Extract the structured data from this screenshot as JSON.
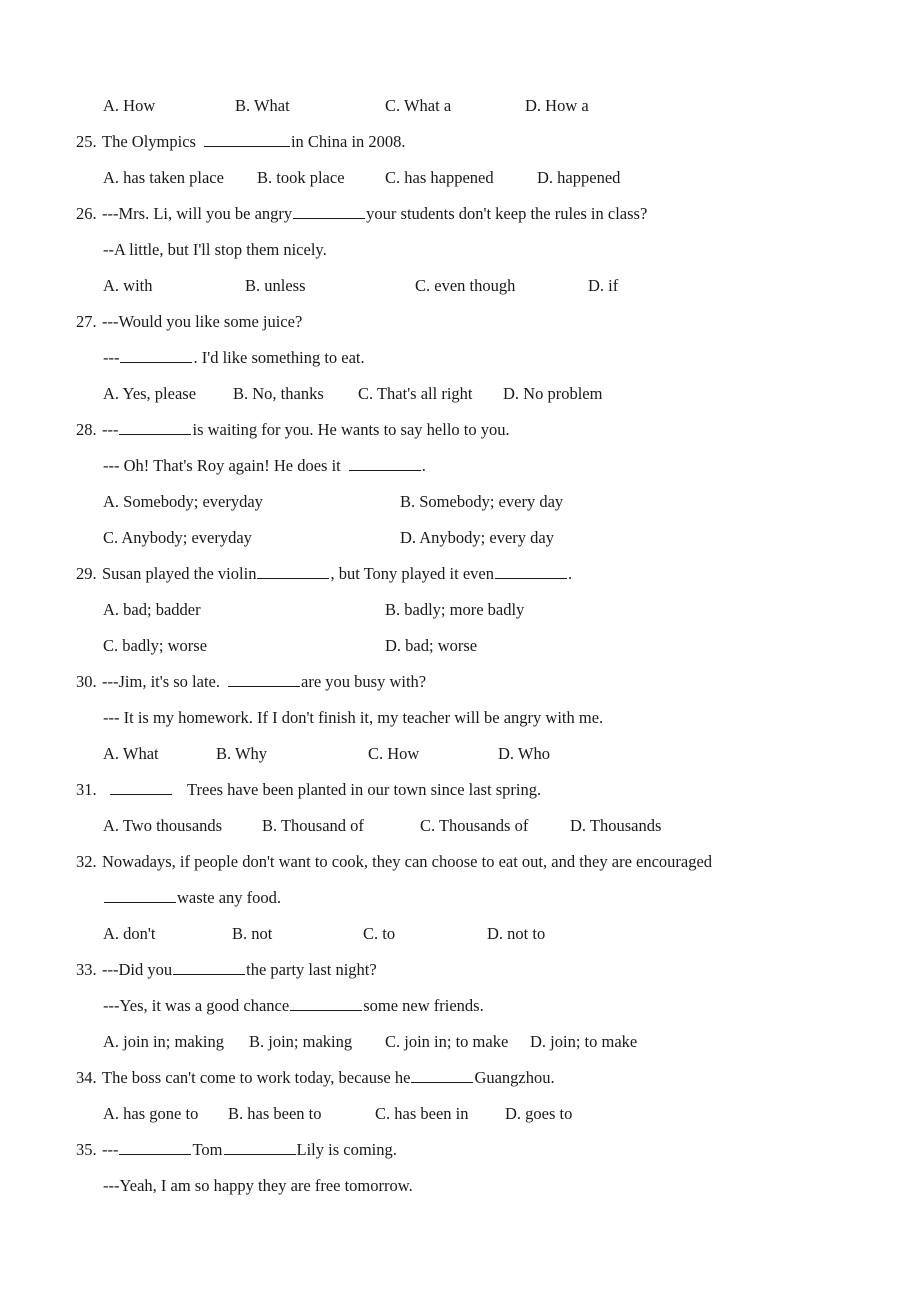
{
  "document": {
    "type": "english-grammar-multiple-choice-worksheet",
    "number_range": "24-35"
  },
  "questions": [
    {
      "id": "q24-options",
      "kind": "options-only",
      "columns": 4,
      "options": [
        "A. How",
        "B. What",
        "C. What a",
        "D. How a"
      ],
      "x": [
        103,
        235,
        385,
        525
      ]
    },
    {
      "id": "q25",
      "number": "25.",
      "stem_before": "The Olympics",
      "stem_after": "in China in 2008.",
      "blank": "b-xl",
      "columns": 4,
      "options": [
        "A. has taken place",
        "B. took place",
        "C. has happened",
        "D. happened"
      ],
      "x": [
        103,
        257,
        385,
        537
      ]
    },
    {
      "id": "q26",
      "number": "26.",
      "stem_before": "---Mrs. Li, will you be angry",
      "stem_after": "your students don't keep the rules in class?",
      "blank": "b-lg",
      "reply": "--A little, but I'll stop them nicely.",
      "columns": 4,
      "options": [
        "A. with",
        "B. unless",
        "C. even though",
        "D. if"
      ],
      "x": [
        103,
        245,
        415,
        588
      ]
    },
    {
      "id": "q27",
      "number": "27.",
      "stem": "---Would you like some juice?",
      "reply_before": "---",
      "reply_after": ". I'd like something to eat.",
      "reply_blank": "b-lg",
      "columns": 4,
      "options": [
        "A. Yes, please",
        "B. No, thanks",
        "C. That's all right",
        "D. No problem"
      ],
      "x": [
        103,
        233,
        358,
        503
      ]
    },
    {
      "id": "q28",
      "number": "28.",
      "stem_before": "---",
      "stem_after": "is waiting for you. He wants to say hello to you.",
      "blank": "b-lg",
      "reply_before": "--- Oh! That's Roy again! He does it",
      "reply_after": ".",
      "reply_blank": "b-lg",
      "columns": 2,
      "options": [
        "A. Somebody; everyday",
        "B. Somebody; every day",
        "C. Anybody; everyday",
        "D. Anybody; every day"
      ],
      "x": [
        103,
        400
      ]
    },
    {
      "id": "q29",
      "number": "29.",
      "stem_before": "Susan played the violin",
      "stem_mid": ", but Tony played it even",
      "stem_after": ".",
      "blank": "b-lg",
      "columns": 2,
      "options": [
        "A. bad; badder",
        "B. badly; more badly",
        "C. badly; worse",
        "D. bad; worse"
      ],
      "x": [
        103,
        385
      ]
    },
    {
      "id": "q30",
      "number": "30.",
      "stem_before": "---Jim, it's so late.",
      "stem_after": "are you busy with?",
      "blank": "b-lg",
      "reply": "--- It is my homework. If I don't finish it, my teacher will be angry with me.",
      "columns": 4,
      "options": [
        "A. What",
        "B. Why",
        "C. How",
        "D. Who"
      ],
      "x": [
        103,
        216,
        368,
        498
      ]
    },
    {
      "id": "q31",
      "number": "31.",
      "stem_before": "",
      "stem_after": "Trees have been planted in our town since last spring.",
      "blank": "b-md",
      "columns": 4,
      "options": [
        "A. Two thousands",
        "B. Thousand of",
        "C. Thousands of",
        "D. Thousands"
      ],
      "x": [
        103,
        262,
        420,
        570
      ]
    },
    {
      "id": "q32",
      "number": "32.",
      "stem_line1": "Nowadays, if people don't want to cook, they can choose to eat out, and they are encouraged",
      "stem_line2_after": "waste any food.",
      "blank": "b-lg",
      "columns": 4,
      "options": [
        "A. don't",
        "B. not",
        "C. to",
        "D. not to"
      ],
      "x": [
        103,
        232,
        363,
        487
      ]
    },
    {
      "id": "q33",
      "number": "33.",
      "stem_before": "---Did you",
      "stem_after": "the party last night?",
      "blank": "b-lg",
      "reply_before": "---Yes, it was a good chance",
      "reply_after": "some new friends.",
      "reply_blank": "b-lg",
      "columns": 4,
      "options": [
        "A. join in; making",
        "B. join; making",
        "C. join in; to make",
        "D. join; to make"
      ],
      "x": [
        103,
        249,
        385,
        530
      ]
    },
    {
      "id": "q34",
      "number": "34.",
      "stem_before": "The boss can't come to work today, because he",
      "stem_after": "Guangzhou.",
      "blank": "b-md",
      "columns": 4,
      "options": [
        "A. has gone to",
        "B. has been to",
        "C. has been in",
        "D. goes to"
      ],
      "x": [
        103,
        228,
        375,
        505
      ]
    },
    {
      "id": "q35",
      "number": "35.",
      "stem_before": "---",
      "stem_mid": "Tom",
      "stem_after": "Lily is coming.",
      "blank": "b-lg",
      "reply": "---Yeah, I am so happy they are free tomorrow."
    }
  ]
}
